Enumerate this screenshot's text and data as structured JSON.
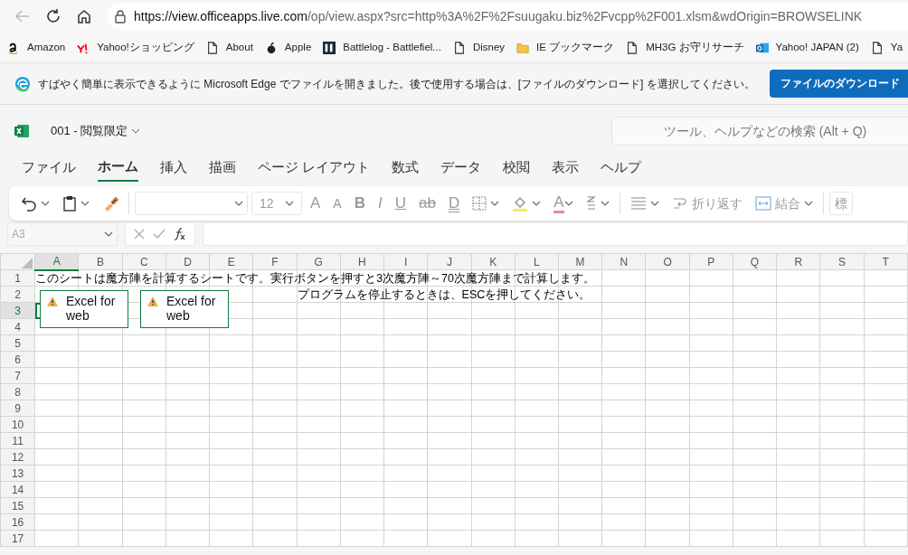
{
  "browser": {
    "url_host": "https://view.officeapps.live.com",
    "url_rest": "/op/view.aspx?src=http%3A%2F%2Fsuugaku.biz%2Fvcpp%2F001.xlsm&wdOrigin=BROWSELINK",
    "bookmarks": [
      {
        "label": "Amazon",
        "kind": "amazon"
      },
      {
        "label": "Yahoo!ショッピング",
        "kind": "yahoo"
      },
      {
        "label": "About",
        "kind": "page"
      },
      {
        "label": "Apple",
        "kind": "apple"
      },
      {
        "label": "Battlelog - Battlefiel...",
        "kind": "bl"
      },
      {
        "label": "Disney",
        "kind": "page"
      },
      {
        "label": "IE ブックマーク",
        "kind": "folder"
      },
      {
        "label": "MH3G お守リサーチ",
        "kind": "page"
      },
      {
        "label": "Yahoo! JAPAN (2)",
        "kind": "outlook"
      },
      {
        "label": "Ya",
        "kind": "page"
      }
    ]
  },
  "infobar": {
    "message": "すばやく簡単に表示できるように Microsoft Edge でファイルを開きました。後で使用する場合は、[ファイルのダウンロード] を選択してください。",
    "button": "ファイルのダウンロード"
  },
  "app": {
    "file_title": "001 - 閲覧限定",
    "search_placeholder": "ツール、ヘルプなどの検索 (Alt + Q)"
  },
  "ribbon_tabs": [
    {
      "label": "ファイル",
      "selected": false
    },
    {
      "label": "ホーム",
      "selected": true
    },
    {
      "label": "挿入",
      "selected": false
    },
    {
      "label": "描画",
      "selected": false
    },
    {
      "label": "ページ レイアウト",
      "selected": false
    },
    {
      "label": "数式",
      "selected": false
    },
    {
      "label": "データ",
      "selected": false
    },
    {
      "label": "校閲",
      "selected": false
    },
    {
      "label": "表示",
      "selected": false
    },
    {
      "label": "ヘルプ",
      "selected": false
    }
  ],
  "toolbar": [
    {
      "kind": "undo"
    },
    {
      "kind": "paste"
    },
    {
      "kind": "painter"
    },
    {
      "kind": "sep"
    },
    {
      "kind": "font"
    },
    {
      "kind": "size",
      "label": "12"
    },
    {
      "kind": "grow",
      "label": "A"
    },
    {
      "kind": "shrink",
      "label": "A"
    },
    {
      "kind": "bold",
      "label": "B"
    },
    {
      "kind": "italic",
      "label": "I"
    },
    {
      "kind": "underline",
      "label": "U"
    },
    {
      "kind": "strike",
      "label": "ab"
    },
    {
      "kind": "double",
      "label": "D"
    },
    {
      "kind": "borders"
    },
    {
      "kind": "fill"
    },
    {
      "kind": "color",
      "label": "A"
    },
    {
      "kind": "orient"
    },
    {
      "kind": "sep"
    },
    {
      "kind": "align"
    },
    {
      "kind": "wrap",
      "label": "折り返す"
    },
    {
      "kind": "merge",
      "label": "結合"
    },
    {
      "kind": "sep"
    },
    {
      "kind": "cut",
      "label": "標"
    }
  ],
  "formula_bar": {
    "name_box": "A3"
  },
  "sheet": {
    "columns": [
      {
        "label": "A",
        "selected": true
      },
      {
        "label": "B",
        "selected": false
      },
      {
        "label": "C",
        "selected": false
      },
      {
        "label": "D",
        "selected": false
      },
      {
        "label": "E",
        "selected": false
      },
      {
        "label": "F",
        "selected": false
      },
      {
        "label": "G",
        "selected": false
      },
      {
        "label": "H",
        "selected": false
      },
      {
        "label": "I",
        "selected": false
      },
      {
        "label": "J",
        "selected": false
      },
      {
        "label": "K",
        "selected": false
      },
      {
        "label": "L",
        "selected": false
      },
      {
        "label": "M",
        "selected": false
      },
      {
        "label": "N",
        "selected": false
      },
      {
        "label": "O",
        "selected": false
      },
      {
        "label": "P",
        "selected": false
      },
      {
        "label": "Q",
        "selected": false
      },
      {
        "label": "R",
        "selected": false
      },
      {
        "label": "S",
        "selected": false
      },
      {
        "label": "T",
        "selected": false
      }
    ],
    "rows": [
      {
        "label": "1",
        "selected": false
      },
      {
        "label": "2",
        "selected": false
      },
      {
        "label": "3",
        "selected": true
      },
      {
        "label": "4",
        "selected": false
      },
      {
        "label": "5",
        "selected": false
      },
      {
        "label": "6",
        "selected": false
      },
      {
        "label": "7",
        "selected": false
      },
      {
        "label": "8",
        "selected": false
      },
      {
        "label": "9",
        "selected": false
      },
      {
        "label": "10",
        "selected": false
      },
      {
        "label": "11",
        "selected": false
      },
      {
        "label": "12",
        "selected": false
      },
      {
        "label": "13",
        "selected": false
      },
      {
        "label": "14",
        "selected": false
      },
      {
        "label": "15",
        "selected": false
      },
      {
        "label": "16",
        "selected": false
      },
      {
        "label": "17",
        "selected": false
      }
    ],
    "notes": [
      "このシートは魔方陣を計算するシートです。実行ボタンを押すと3次魔方陣～70次魔方陣まで計算します。",
      "プログラムを停止するときは、ESCを押してください。"
    ],
    "controls": [
      {
        "text": "Excel for web"
      },
      {
        "text": "Excel for web"
      }
    ]
  }
}
